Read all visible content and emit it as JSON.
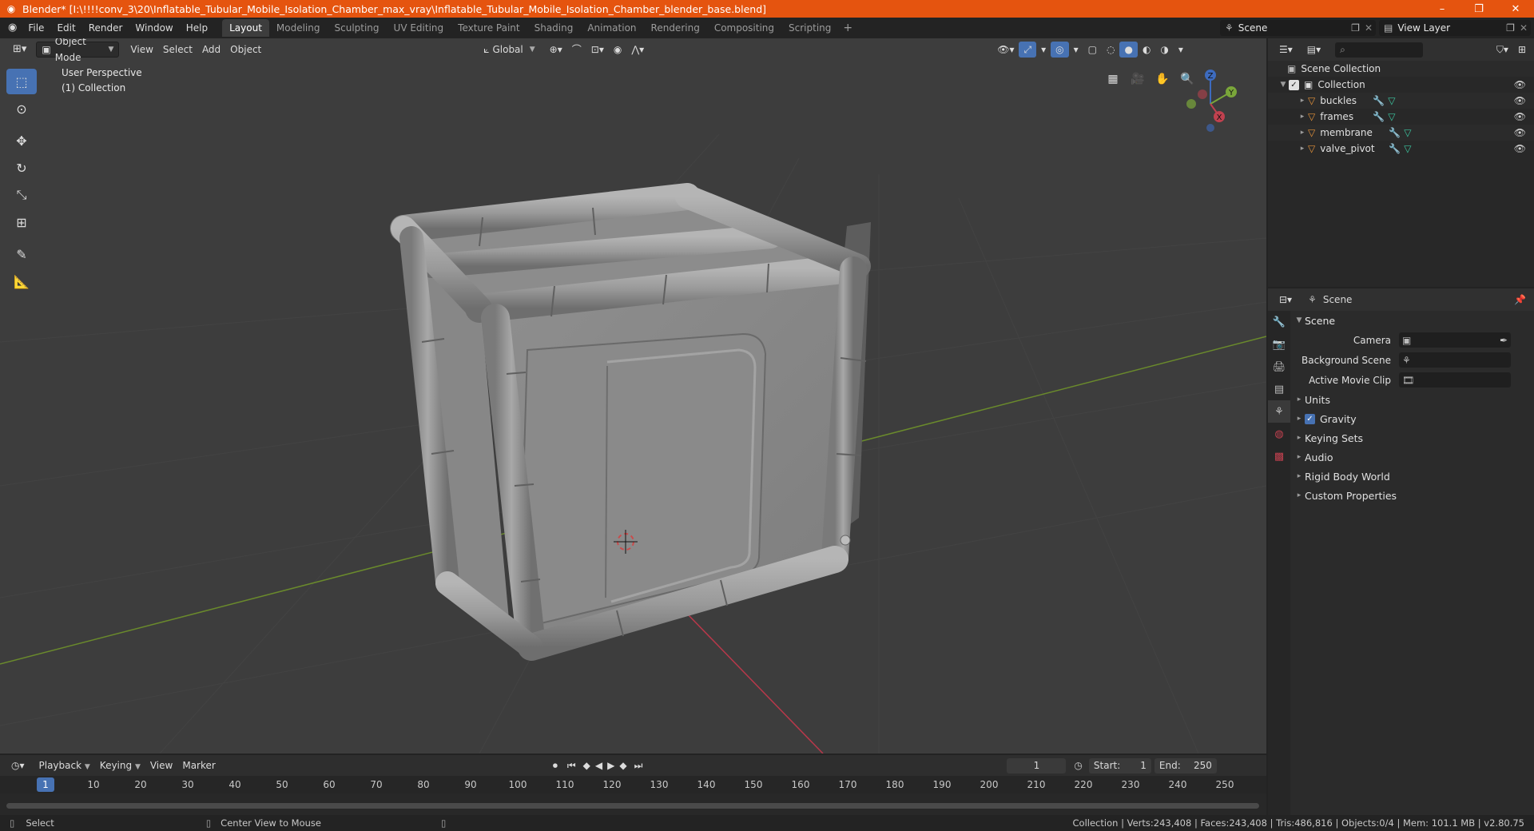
{
  "window": {
    "title": "Blender* [I:\\!!!!conv_3\\20\\Inflatable_Tubular_Mobile_Isolation_Chamber_max_vray\\Inflatable_Tubular_Mobile_Isolation_Chamber_blender_base.blend]",
    "minimize": "–",
    "maximize": "❐",
    "close": "✕"
  },
  "menu": [
    "File",
    "Edit",
    "Render",
    "Window",
    "Help"
  ],
  "workspaces": [
    "Layout",
    "Modeling",
    "Sculpting",
    "UV Editing",
    "Texture Paint",
    "Shading",
    "Animation",
    "Rendering",
    "Compositing",
    "Scripting"
  ],
  "active_workspace": "Layout",
  "scene_selector": "Scene",
  "view_layer_selector": "View Layer",
  "viewport": {
    "mode": "Object Mode",
    "menus": [
      "View",
      "Select",
      "Add",
      "Object"
    ],
    "orientation": "Global",
    "info_line1": "User Perspective",
    "info_line2": "(1) Collection",
    "gizmo_labels": {
      "z": "Z",
      "y": "Y",
      "x": "X"
    }
  },
  "outliner": {
    "root": "Scene Collection",
    "collection": "Collection",
    "objects": [
      "buckles",
      "frames",
      "membrane",
      "valve_pivot"
    ]
  },
  "properties": {
    "header": "Scene",
    "section": "Scene",
    "fields": [
      {
        "label": "Camera",
        "value": ""
      },
      {
        "label": "Background Scene",
        "value": ""
      },
      {
        "label": "Active Movie Clip",
        "value": ""
      }
    ],
    "subsections": [
      "Units",
      "Gravity",
      "Keying Sets",
      "Audio",
      "Rigid Body World",
      "Custom Properties"
    ],
    "gravity_checked": true
  },
  "timeline": {
    "menus": [
      "Playback",
      "Keying",
      "View",
      "Marker"
    ],
    "current_frame": "1",
    "start_label": "Start:",
    "start": "1",
    "end_label": "End:",
    "end": "250",
    "ruler_current": "1",
    "ruler": [
      "10",
      "20",
      "30",
      "40",
      "50",
      "60",
      "70",
      "80",
      "90",
      "100",
      "110",
      "120",
      "130",
      "140",
      "150",
      "160",
      "170",
      "180",
      "190",
      "200",
      "210",
      "220",
      "230",
      "240",
      "250"
    ]
  },
  "statusbar": {
    "left_action": "Select",
    "middle_action": "Center View to Mouse",
    "stats": "Collection | Verts:243,408 | Faces:243,408 | Tris:486,816 | Objects:0/4 | Mem: 101.1 MB | v2.80.75"
  },
  "colors": {
    "titlebar": "#e5540f",
    "accent": "#4772b3",
    "viewport_bg": "#3d3d3d",
    "axis_x": "#c0414f",
    "axis_y": "#7aa63a",
    "mesh": "#8d8d8d"
  }
}
